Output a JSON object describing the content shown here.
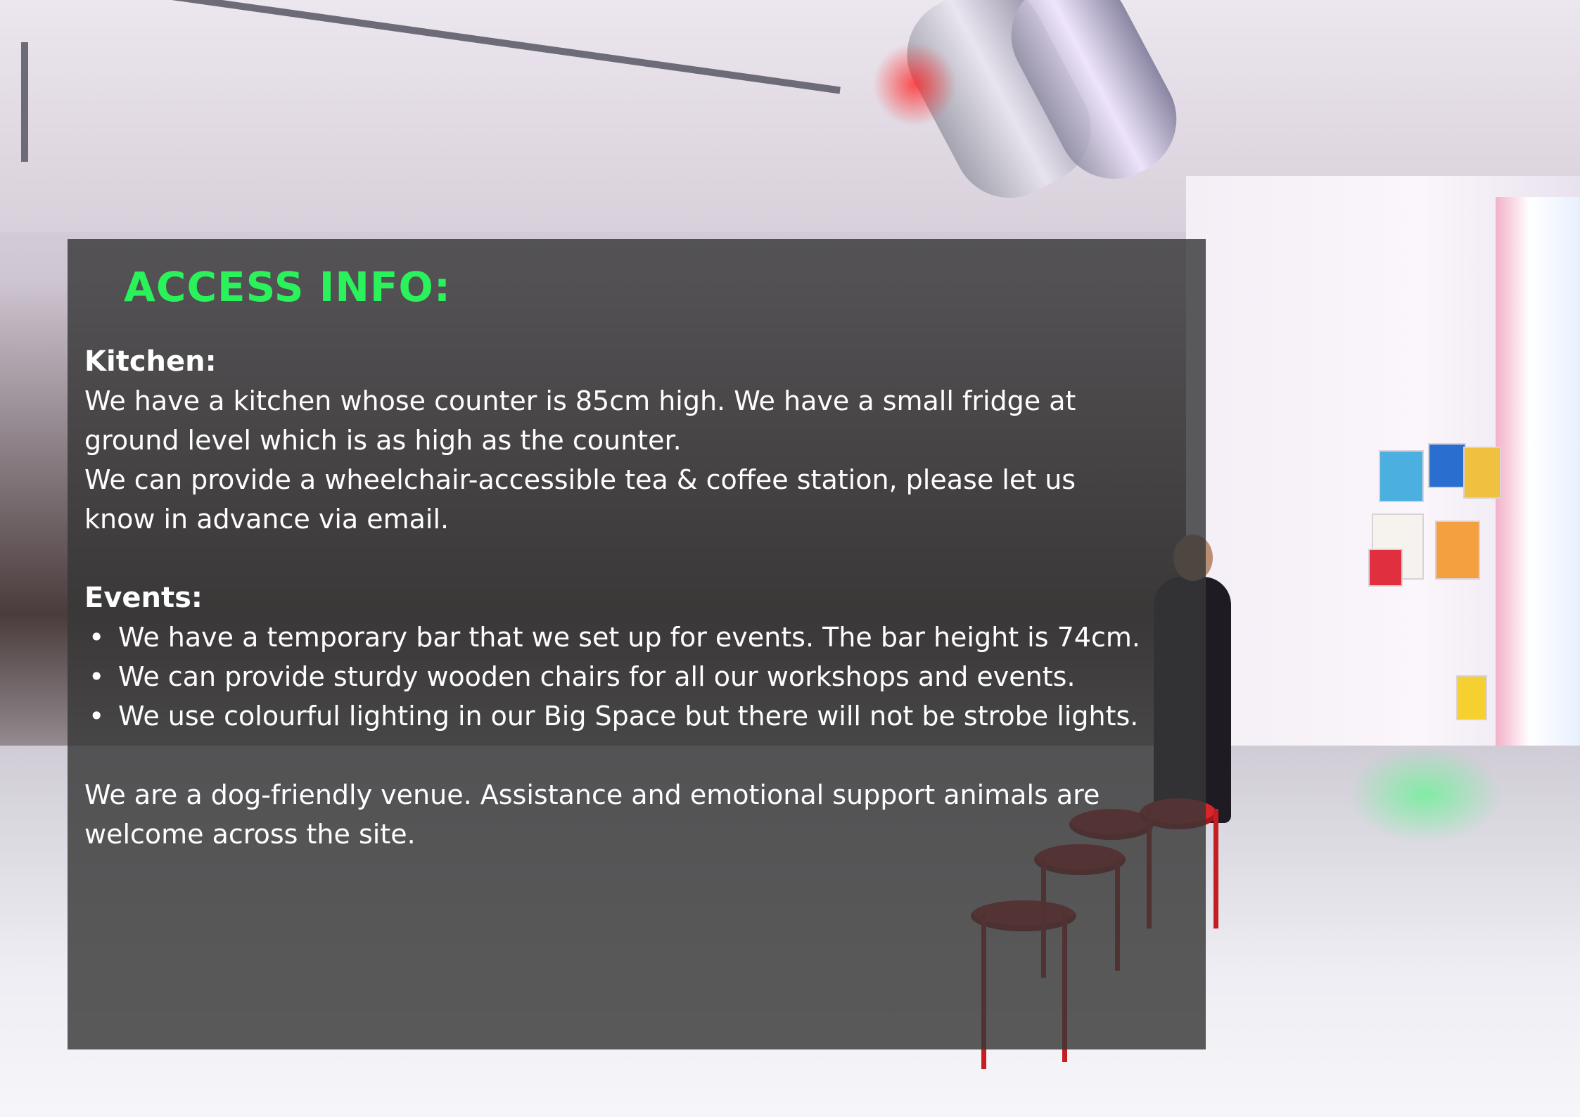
{
  "title": "ACCESS INFO:",
  "kitchen": {
    "heading": "Kitchen:",
    "line1": "We have a kitchen whose counter is 85cm high. We have a small fridge at",
    "line2": "ground level which is as high as the counter.",
    "line3": "We can provide a wheelchair-accessible tea & coffee station, please let us",
    "line4": "know in advance via email."
  },
  "events": {
    "heading": "Events:",
    "items": [
      "We have a temporary bar that we set up for events. The bar height is 74cm.",
      "We can provide sturdy wooden chairs for all our workshops and events.",
      "We use colourful lighting in our Big Space but there will not be strobe lights."
    ]
  },
  "animals": {
    "line1": "We are a dog-friendly venue. Assistance and emotional support animals are",
    "line2": "welcome across the site."
  },
  "colors": {
    "title_green": "#2af25a",
    "panel_bg": "rgba(55,55,55,0.82)",
    "text": "#ffffff"
  }
}
